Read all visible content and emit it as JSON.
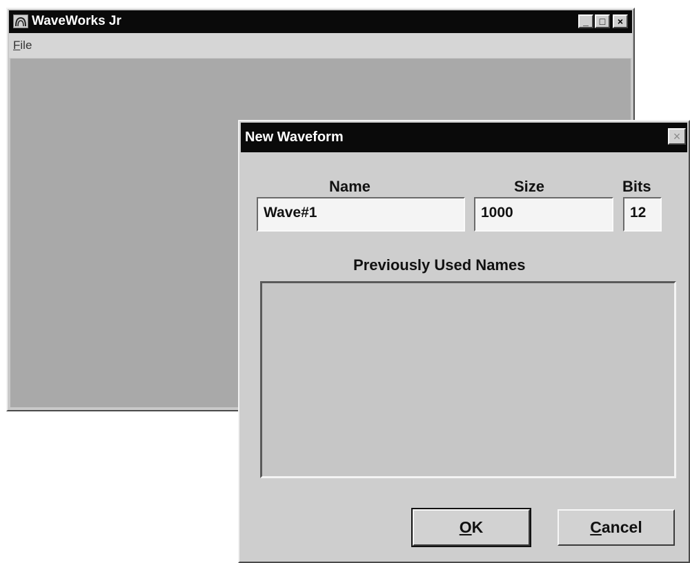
{
  "main_window": {
    "title": "WaveWorks Jr",
    "icon": "app-icon",
    "controls": {
      "minimize": "_",
      "maximize": "□",
      "close": "×"
    },
    "menu": [
      {
        "label_access": "F",
        "label_rest": "ile"
      }
    ]
  },
  "dialog": {
    "title": "New Waveform",
    "close_glyph": "×",
    "name_label": "Name",
    "size_label": "Size",
    "bits_label": "Bits",
    "name_value": "Wave#1",
    "size_value": "1000",
    "bits_value": "12",
    "list_label": "Previously Used Names",
    "list_items": [],
    "ok_access": "O",
    "ok_rest": "K",
    "cancel_access": "C",
    "cancel_rest": "ancel"
  }
}
